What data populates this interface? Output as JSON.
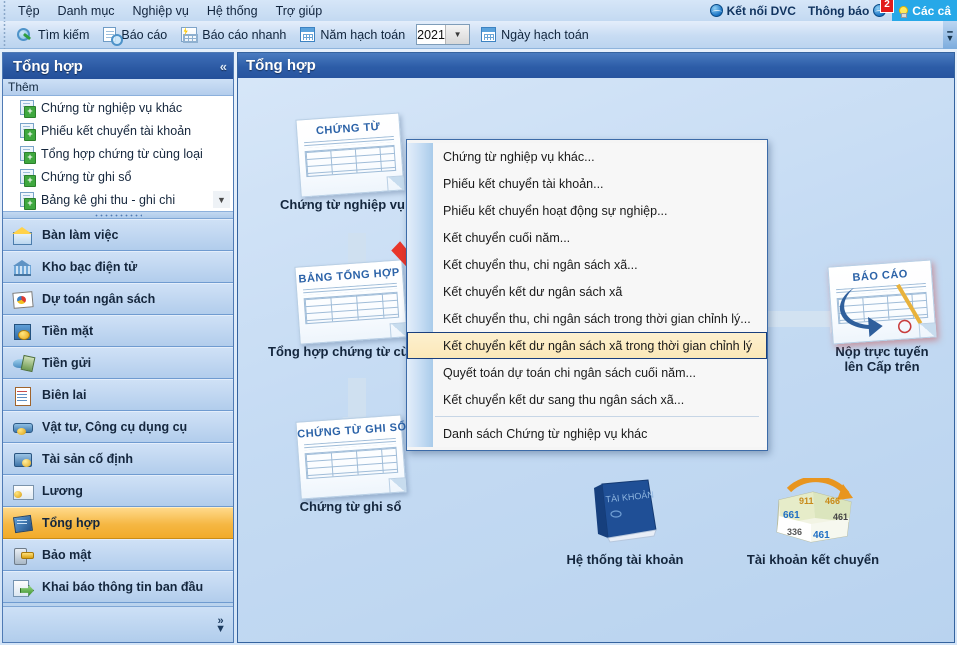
{
  "menubar": {
    "items": [
      "Tệp",
      "Danh mục",
      "Nghiệp vụ",
      "Hệ thống",
      "Trợ giúp"
    ],
    "right": {
      "connect": "Kết nối DVC",
      "notify": "Thông báo",
      "notify_badge": "2",
      "tips": "Các câ"
    }
  },
  "toolbar": {
    "search": "Tìm kiếm",
    "report": "Báo cáo",
    "fast_report": "Báo cáo nhanh",
    "fiscal_year_label": "Năm hạch toán",
    "fiscal_year_value": "2021",
    "posting_date": "Ngày hạch toán"
  },
  "sidebar": {
    "title": "Tổng hợp",
    "section_label": "Thêm",
    "add_items": [
      "Chứng từ nghiệp vụ khác",
      "Phiếu kết chuyển tài khoản",
      "Tổng hợp chứng từ cùng loại",
      "Chứng từ ghi sổ",
      "Bảng kê ghi thu - ghi chi"
    ],
    "nav": [
      {
        "label": "Bàn làm việc",
        "icon": "home-icon",
        "active": false
      },
      {
        "label": "Kho bạc điện tử",
        "icon": "bank-icon",
        "active": false
      },
      {
        "label": "Dự toán ngân sách",
        "icon": "budget-icon",
        "active": false
      },
      {
        "label": "Tiền mặt",
        "icon": "cash-icon",
        "active": false
      },
      {
        "label": "Tiền gửi",
        "icon": "deposit-icon",
        "active": false
      },
      {
        "label": "Biên lai",
        "icon": "receipt-icon",
        "active": false
      },
      {
        "label": "Vật tư, Công cụ dụng cụ",
        "icon": "material-icon",
        "active": false
      },
      {
        "label": "Tài sản cố định",
        "icon": "asset-icon",
        "active": false
      },
      {
        "label": "Lương",
        "icon": "salary-icon",
        "active": false
      },
      {
        "label": "Tổng hợp",
        "icon": "general-icon",
        "active": true
      },
      {
        "label": "Bảo mật",
        "icon": "security-icon",
        "active": false
      },
      {
        "label": "Khai báo thông tin ban đầu",
        "icon": "declare-icon",
        "active": false
      }
    ]
  },
  "content": {
    "title": "Tổng hợp",
    "nodes": [
      {
        "id": "chungtu",
        "paper_title": "CHỨNG TỪ",
        "label": "Chứng từ nghiệp vụ khác"
      },
      {
        "id": "bangtonghop",
        "paper_title": "BẢNG TỔNG HỢP",
        "label": "Tổng hợp chứng từ cùng loại"
      },
      {
        "id": "chungtughiso",
        "paper_title": "CHỨNG TỪ GHI SỔ",
        "label": "Chứng từ ghi sổ"
      },
      {
        "id": "baocao",
        "paper_title": "BÁO CÁO",
        "label_line1": "Nộp trực tuyến",
        "label_line2": "lên Cấp trên"
      }
    ],
    "bottom_nodes": [
      {
        "id": "hethongtaikhoan",
        "book_title": "TÀI KHOẢN",
        "label": "Hệ thống tài khoản"
      },
      {
        "id": "taikhoanketchuyen",
        "label": "Tài khoản kết chuyển",
        "numbers": [
          "911",
          "466",
          "661",
          "461",
          "336",
          "461"
        ]
      }
    ]
  },
  "context_menu": {
    "items": [
      {
        "label": "Chứng từ nghiệp vụ khác...",
        "selected": false,
        "separator_before": false
      },
      {
        "label": "Phiếu kết chuyển tài khoản...",
        "selected": false,
        "separator_before": false
      },
      {
        "label": "Phiếu kết chuyển hoạt động sự nghiệp...",
        "selected": false,
        "separator_before": false
      },
      {
        "label": "Kết chuyển cuối năm...",
        "selected": false,
        "separator_before": false
      },
      {
        "label": "Kết chuyển thu, chi ngân sách xã...",
        "selected": false,
        "separator_before": false
      },
      {
        "label": "Kết chuyển kết dư ngân sách xã",
        "selected": false,
        "separator_before": false
      },
      {
        "label": "Kết chuyển thu, chi ngân sách trong thời gian chỉnh lý...",
        "selected": false,
        "separator_before": false
      },
      {
        "label": "Kết chuyển kết dư ngân sách xã trong thời gian chỉnh lý",
        "selected": true,
        "separator_before": false
      },
      {
        "label": "Quyết toán dự toán chi ngân sách cuối năm...",
        "selected": false,
        "separator_before": false
      },
      {
        "label": "Kết chuyển kết dư sang thu ngân sách xã...",
        "selected": false,
        "separator_before": false
      },
      {
        "label": "Danh sách Chứng từ nghiệp vụ khác",
        "selected": false,
        "separator_before": true
      }
    ]
  },
  "colors": {
    "accent_blue": "#2d5da8",
    "highlight_orange": "#f5b743",
    "badge_red": "#e21b1b",
    "arrow_red": "#e8362a",
    "tips_cyan": "#27a8e8"
  }
}
